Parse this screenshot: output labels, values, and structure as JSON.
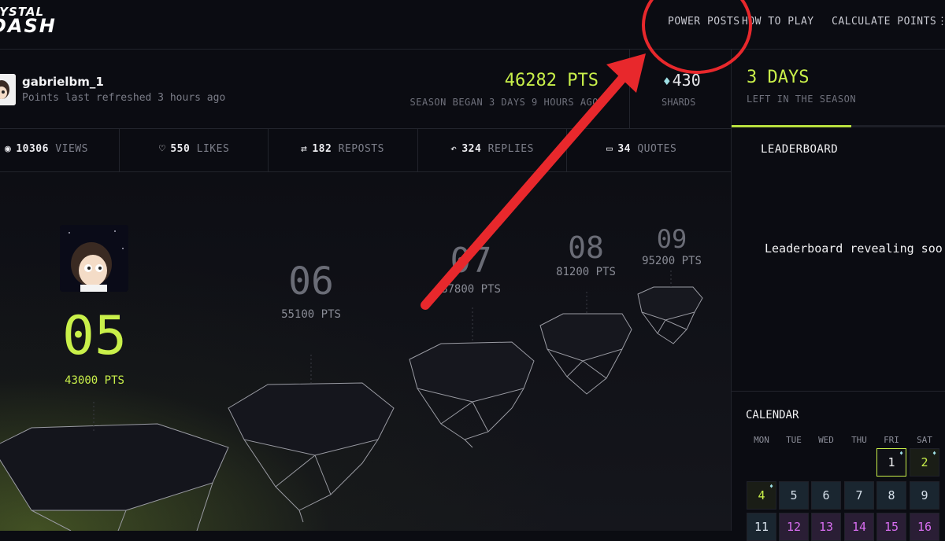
{
  "logo": {
    "line1": "RYSTAL",
    "line2": "DASH"
  },
  "nav": {
    "power_posts": "POWER POSTS",
    "how_to_play": "HOW TO PLAY",
    "calculate_points": "CALCULATE POINTS"
  },
  "profile": {
    "username": "gabrielbm_1",
    "refreshed": "Points last refreshed 3 hours ago",
    "points": "46282 PTS",
    "season_began": "SEASON BEGAN 3 DAYS 9 HOURS AGO",
    "shards_value": "430",
    "shards_label": "SHARDS"
  },
  "season": {
    "days": "3 DAYS",
    "sub": "LEFT IN THE SEASON",
    "progress": 0.56
  },
  "stats": [
    {
      "value": "10306",
      "label": "VIEWS",
      "icon": "eye-icon"
    },
    {
      "value": "550",
      "label": "LIKES",
      "icon": "heart-icon"
    },
    {
      "value": "182",
      "label": "REPOSTS",
      "icon": "repost-icon"
    },
    {
      "value": "324",
      "label": "REPLIES",
      "icon": "reply-icon"
    },
    {
      "value": "34",
      "label": "QUOTES",
      "icon": "quote-icon"
    }
  ],
  "leaderboard": {
    "title": "LEADERBOARD",
    "message": "Leaderboard revealing soo"
  },
  "ranks": [
    {
      "num": "05",
      "pts": "43000 PTS"
    },
    {
      "num": "06",
      "pts": "55100 PTS"
    },
    {
      "num": "07",
      "pts": "87800 PTS"
    },
    {
      "num": "08",
      "pts": "81200 PTS"
    },
    {
      "num": "09",
      "pts": "95200 PTS"
    }
  ],
  "calendar": {
    "title": "CALENDAR",
    "days_of_week": [
      "MON",
      "TUE",
      "WED",
      "THU",
      "FRI",
      "SAT"
    ],
    "row1": [
      "1",
      "2"
    ],
    "row2": [
      "4",
      "5",
      "6",
      "7",
      "8",
      "9"
    ],
    "row3": [
      "11",
      "12",
      "13",
      "14",
      "15",
      "16"
    ]
  },
  "colors": {
    "accent": "#c9f04a",
    "annotation": "#e8282c",
    "background": "#0b0c12"
  }
}
